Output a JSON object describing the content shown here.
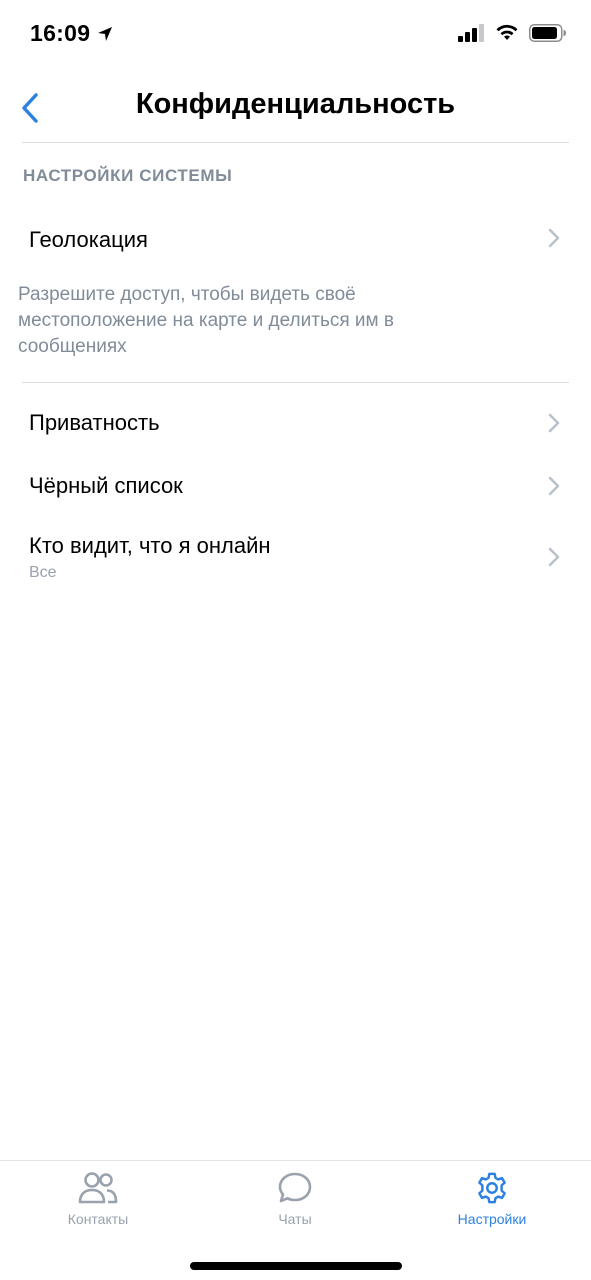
{
  "status_bar": {
    "time": "16:09"
  },
  "nav": {
    "title": "Конфиденциальность",
    "back_icon": "chevron-left-icon"
  },
  "section": {
    "header": "НАСТРОЙКИ СИСТЕМЫ"
  },
  "geolocation": {
    "title": "Геолокация",
    "footer": "Разрешите доступ, чтобы видеть своё местоположение на карте и делиться им в сообщениях"
  },
  "items": [
    {
      "title": "Приватность"
    },
    {
      "title": "Чёрный список"
    },
    {
      "title": "Кто видит, что я онлайн",
      "subtitle": "Все"
    }
  ],
  "tabs": [
    {
      "label": "Контакты",
      "icon": "contacts-icon",
      "active": false
    },
    {
      "label": "Чаты",
      "icon": "chat-bubble-icon",
      "active": false
    },
    {
      "label": "Настройки",
      "icon": "gear-icon",
      "active": true
    }
  ],
  "colors": {
    "accent": "#2d81e0",
    "secondary_text": "#818c99",
    "inactive_icon": "#99a2ad",
    "separator": "#dcdcdf"
  }
}
